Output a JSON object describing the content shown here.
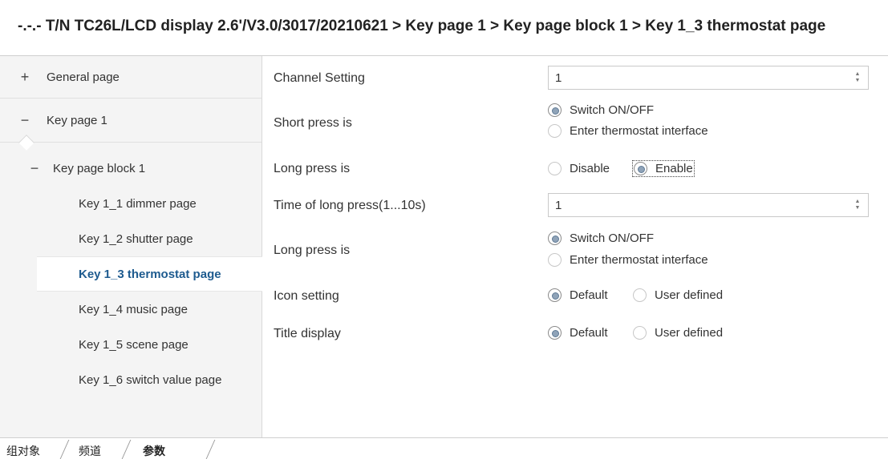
{
  "window": {
    "breadcrumb": "-.-.- T/N TC26L/LCD display 2.6'/V3.0/3017/20210621 > Key page 1 > Key page block 1 > Key 1_3 thermostat page"
  },
  "sidebar": {
    "general": {
      "expander": "+",
      "label": "General page"
    },
    "key_page": {
      "expander": "−",
      "label": "Key page 1"
    },
    "key_block": {
      "expander": "−",
      "label": "Key page block 1"
    },
    "pages": [
      {
        "label": "Key 1_1 dimmer page"
      },
      {
        "label": "Key 1_2 shutter page"
      },
      {
        "label": "Key 1_3 thermostat page",
        "selected": true
      },
      {
        "label": "Key 1_4 music page"
      },
      {
        "label": "Key 1_5 scene page"
      },
      {
        "label": "Key 1_6 switch value page"
      }
    ]
  },
  "params": {
    "channel_setting": {
      "label": "Channel Setting",
      "value": "1"
    },
    "short_press": {
      "label": "Short press is",
      "options": [
        "Switch ON/OFF",
        "Enter thermostat interface"
      ],
      "selected": "Switch ON/OFF"
    },
    "long_press_enable": {
      "label": "Long press is",
      "options": [
        "Disable",
        "Enable"
      ],
      "selected": "Enable"
    },
    "long_press_time": {
      "label": "Time of long press(1...10s)",
      "value": "1"
    },
    "long_press_action": {
      "label": "Long press is",
      "options": [
        "Switch ON/OFF",
        "Enter thermostat interface"
      ],
      "selected": "Switch ON/OFF"
    },
    "icon_setting": {
      "label": "Icon setting",
      "options": [
        "Default",
        "User defined"
      ],
      "selected": "Default"
    },
    "title_display": {
      "label": "Title display",
      "options": [
        "Default",
        "User defined"
      ],
      "selected": "Default"
    }
  },
  "spinner": {
    "up": "▲",
    "down": "▼"
  },
  "bottom_tabs": [
    "组对象",
    "频道",
    "参数"
  ],
  "colors": {
    "selected_text": "#1e5b8f",
    "sidebar_bg": "#f4f4f4"
  }
}
